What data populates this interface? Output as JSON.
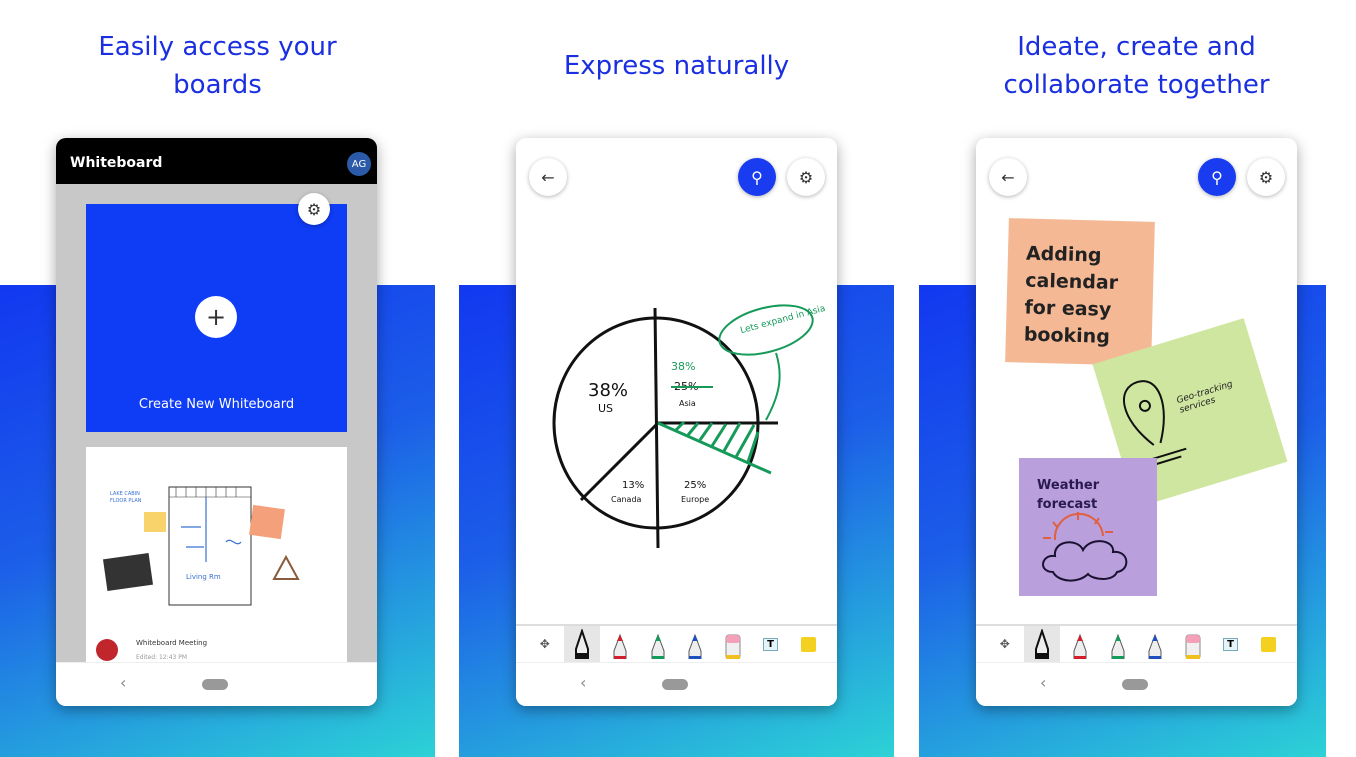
{
  "captions": [
    "Easily access your boards",
    "Express naturally",
    "Ideate, create and collaborate together"
  ],
  "colors": {
    "accent": "#1a3cf0",
    "gradient_end": "#2cd2d6",
    "pen_black": "#111111",
    "pen_red": "#d0202c",
    "pen_green": "#169a5a",
    "pen_blue": "#2050c0"
  },
  "screen1": {
    "app_title": "Whiteboard",
    "avatar_initials": "AG",
    "create_label": "Create New Whiteboard",
    "board_title": "Whiteboard Meeting",
    "board_edited": "Edited: 12:43 PM",
    "settings_icon": "gear-icon",
    "add_icon": "plus-icon"
  },
  "screen2": {
    "pie": {
      "us": "38%",
      "us_label": "US",
      "asia_new": "38%",
      "asia_old": "25%",
      "asia_label": "Asia",
      "canada": "13%",
      "canada_label": "Canada",
      "europe": "25%",
      "europe_label": "Europe"
    },
    "annotation": "Lets expand in Asia"
  },
  "screen3": {
    "note1": "Adding calendar for easy booking",
    "note2": "Geo-tracking services",
    "note3": "Weather forecast"
  },
  "toolbar_icons": [
    "move-icon",
    "black-pen-icon",
    "red-pen-icon",
    "green-pen-icon",
    "blue-pen-icon",
    "eraser-icon",
    "text-icon",
    "sticky-note-icon"
  ]
}
